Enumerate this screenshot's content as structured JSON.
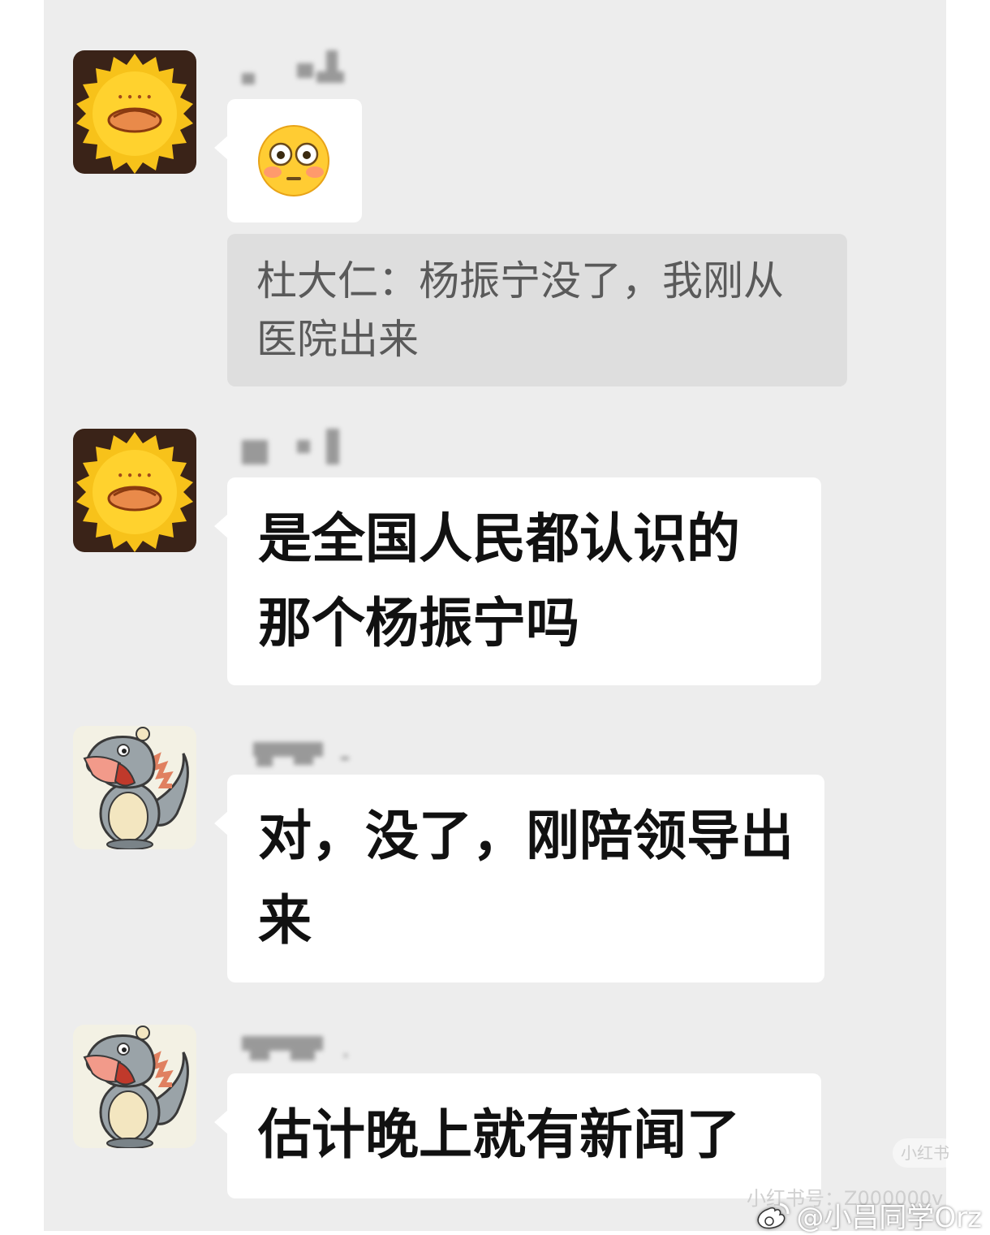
{
  "messages": [
    {
      "avatar": "sun-food-avatar",
      "emoji": "flushed-face-emoji"
    },
    {
      "quote": "杜大仁：杨振宁没了，我刚从医院出来"
    },
    {
      "avatar": "sun-food-avatar",
      "text": "是全国人民都认识的那个杨振宁吗"
    },
    {
      "avatar": "cartoon-dragon-avatar",
      "text": "对，没了，刚陪领导出来"
    },
    {
      "avatar": "cartoon-dragon-avatar",
      "text": "估计晚上就有新闻了"
    }
  ],
  "watermark": {
    "badge": "小红书",
    "line": "小红书号：Z000000v",
    "weibo_handle": "@小吕同学Orz"
  }
}
